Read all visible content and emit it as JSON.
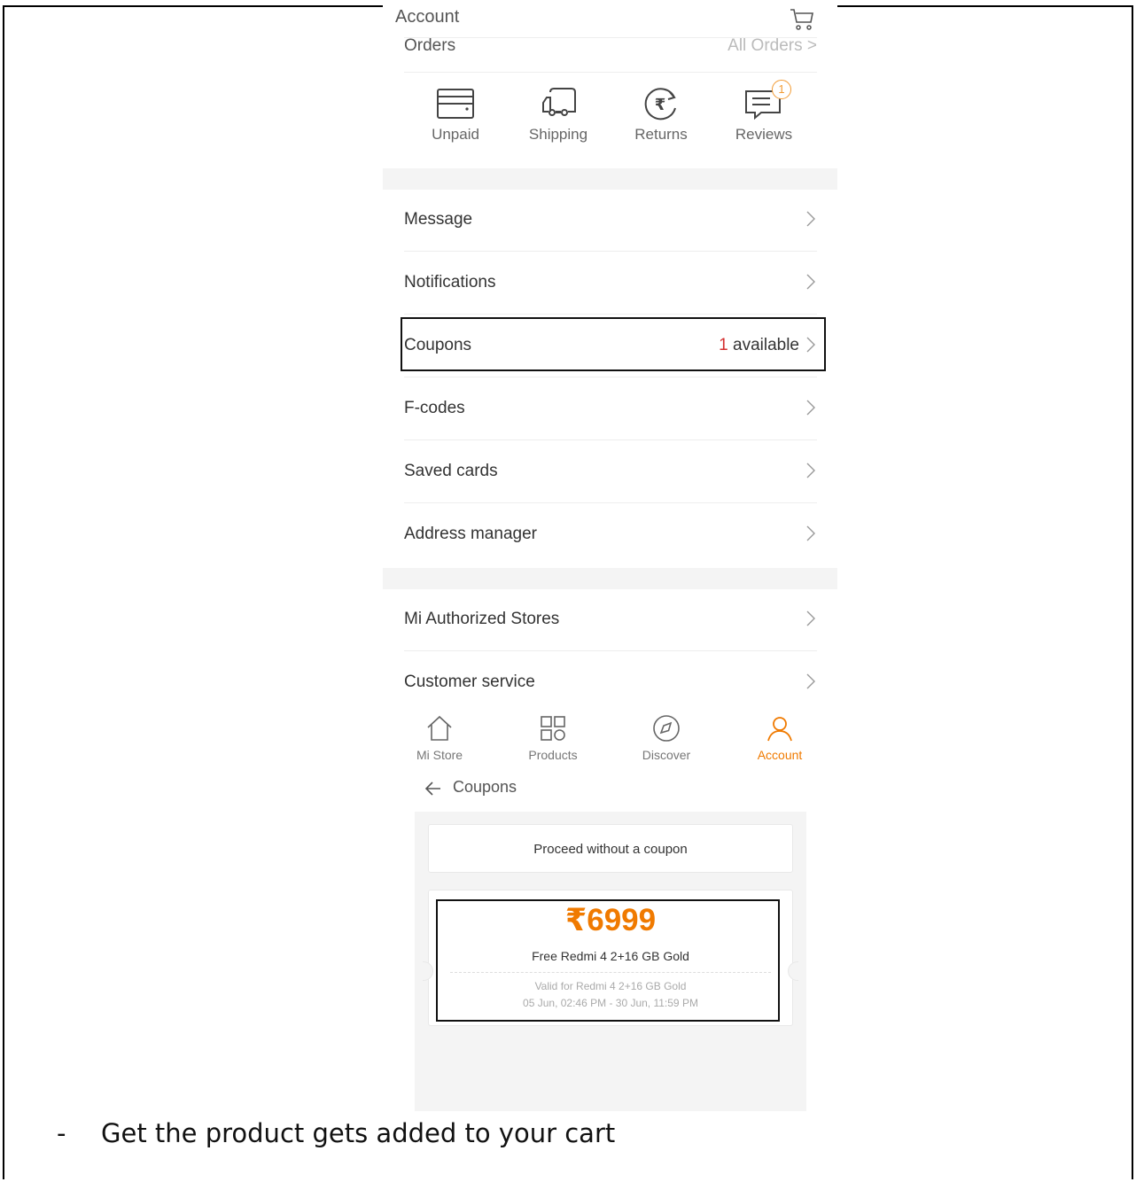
{
  "app_header": {
    "title": "Account",
    "cart_icon": "cart-icon"
  },
  "orders": {
    "title": "Orders",
    "all_orders": "All Orders >"
  },
  "order_status": [
    {
      "label": "Unpaid",
      "icon": "wallet-icon"
    },
    {
      "label": "Shipping",
      "icon": "truck-icon"
    },
    {
      "label": "Returns",
      "icon": "rupee-return-icon"
    },
    {
      "label": "Reviews",
      "icon": "message-icon",
      "badge": "1"
    }
  ],
  "menu": {
    "message": "Message",
    "notifications": "Notifications",
    "coupons": "Coupons",
    "coupons_count": "1",
    "coupons_available": " available",
    "fcodes": "F-codes",
    "saved_cards": "Saved cards",
    "address_manager": "Address manager",
    "mi_stores": "Mi Authorized Stores",
    "customer_service": "Customer service"
  },
  "bottom_nav": [
    {
      "label": "Mi Store",
      "icon": "home-icon"
    },
    {
      "label": "Products",
      "icon": "grid-icon"
    },
    {
      "label": "Discover",
      "icon": "compass-icon"
    },
    {
      "label": "Account",
      "icon": "person-icon",
      "active": true
    }
  ],
  "coupons_screen": {
    "title": "Coupons",
    "proceed": "Proceed without a coupon",
    "coupon": {
      "price": "₹6999",
      "name": "Free Redmi 4 2+16 GB Gold",
      "valid_for": "Valid for Redmi 4 2+16 GB Gold",
      "dates": "05 Jun, 02:46 PM - 30 Jun, 11:59 PM"
    }
  },
  "caption": {
    "bullet": "-",
    "text": "Get the product gets added to your cart"
  },
  "colors": {
    "accent": "#f07a00",
    "badge": "#f29b34",
    "count": "#d32f2f"
  }
}
